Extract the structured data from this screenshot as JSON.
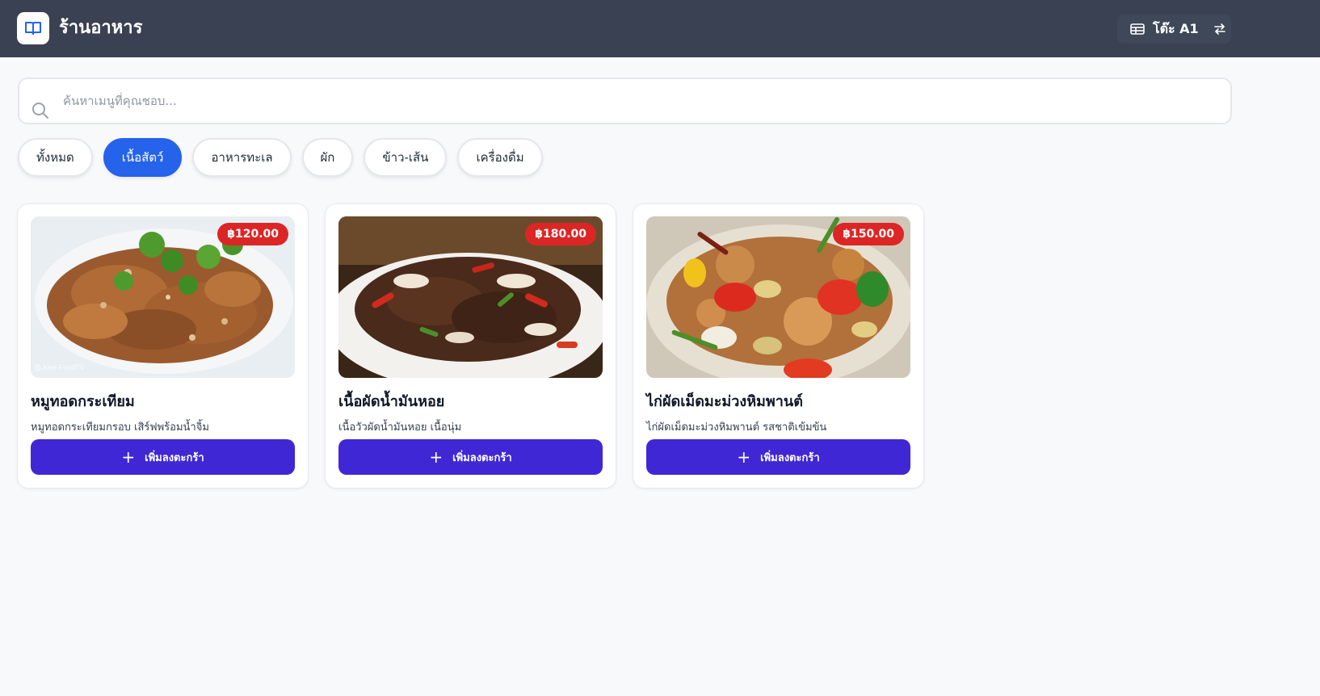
{
  "header": {
    "title": "ร้านอาหาร",
    "table_label": "โต๊ะ A1",
    "icons": [
      "book-icon",
      "table-icon",
      "swap-icon"
    ]
  },
  "search": {
    "placeholder": "ค้นหาเมนูที่คุณชอบ...",
    "value": ""
  },
  "categories": [
    {
      "label": "ทั้งหมด",
      "active": false
    },
    {
      "label": "เนื้อสัตว์",
      "active": true
    },
    {
      "label": "อาหารทะเล",
      "active": false
    },
    {
      "label": "ผัก",
      "active": false
    },
    {
      "label": "ข้าว-เส้น",
      "active": false
    },
    {
      "label": "เครื่องดื่ม",
      "active": false
    }
  ],
  "menu_items": [
    {
      "name": "หมูทอดกระเทียม",
      "description": "หมูทอดกระเทียมกรอบ เสิร์ฟพร้อมน้ำจิ้ม",
      "price": "฿120.00",
      "button": "เพิ่มลงตะกร้า",
      "image": "fried-pork-garlic-photo",
      "watermark": "@Joke FoodTV"
    },
    {
      "name": "เนื้อผัดน้ำมันหอย",
      "description": "เนื้อวัวผัดน้ำมันหอย เนื้อนุ่ม",
      "price": "฿180.00",
      "button": "เพิ่มลงตะกร้า",
      "image": "beef-oyster-sauce-photo"
    },
    {
      "name": "ไก่ผัดเม็ดมะม่วงหิมพานต์",
      "description": "ไก่ผัดเม็ดมะม่วงหิมพานต์ รสชาติเข้มข้น",
      "price": "฿150.00",
      "button": "เพิ่มลงตะกร้า",
      "image": "cashew-chicken-photo"
    }
  ],
  "colors": {
    "header_bg": "#394152",
    "active_category": "#2563eb",
    "price_badge": "#dc2626",
    "add_button": "#4027d6"
  }
}
